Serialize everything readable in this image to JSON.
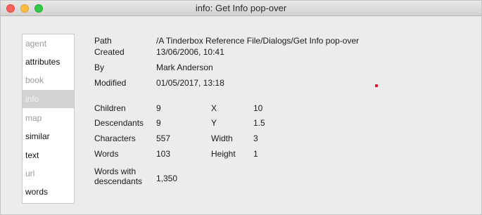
{
  "window": {
    "title": "info: Get Info pop-over"
  },
  "sidebar": {
    "items": [
      {
        "label": "agent",
        "state": "dim"
      },
      {
        "label": "attributes",
        "state": "strong"
      },
      {
        "label": "book",
        "state": "dim"
      },
      {
        "label": "info",
        "state": "selected"
      },
      {
        "label": "map",
        "state": "dim"
      },
      {
        "label": "similar",
        "state": "strong"
      },
      {
        "label": "text",
        "state": "strong"
      },
      {
        "label": "url",
        "state": "dim"
      },
      {
        "label": "words",
        "state": "strong"
      }
    ]
  },
  "info": {
    "path_label": "Path",
    "path_value": "/A Tinderbox Reference File/Dialogs/Get Info pop-over",
    "created_label": "Created",
    "created_value": "13/06/2006, 10:41",
    "by_label": "By",
    "by_value": "Mark Anderson",
    "modified_label": "Modified",
    "modified_value": "01/05/2017, 13:18",
    "children_label": "Children",
    "children_value": "9",
    "descendants_label": "Descendants",
    "descendants_value": "9",
    "characters_label": "Characters",
    "characters_value": "557",
    "words_label": "Words",
    "words_value": "103",
    "words_desc_label": "Words with descendants",
    "words_desc_value": "1,350",
    "x_label": "X",
    "x_value": "10",
    "y_label": "Y",
    "y_value": "1.5",
    "width_label": "Width",
    "width_value": "3",
    "height_label": "Height",
    "height_value": "1"
  },
  "colors": {
    "close": "#fc605c",
    "minimize": "#fdbc40",
    "maximize": "#34c84a",
    "selected_row": "#d2d2d2",
    "marker": "#e0141c"
  }
}
